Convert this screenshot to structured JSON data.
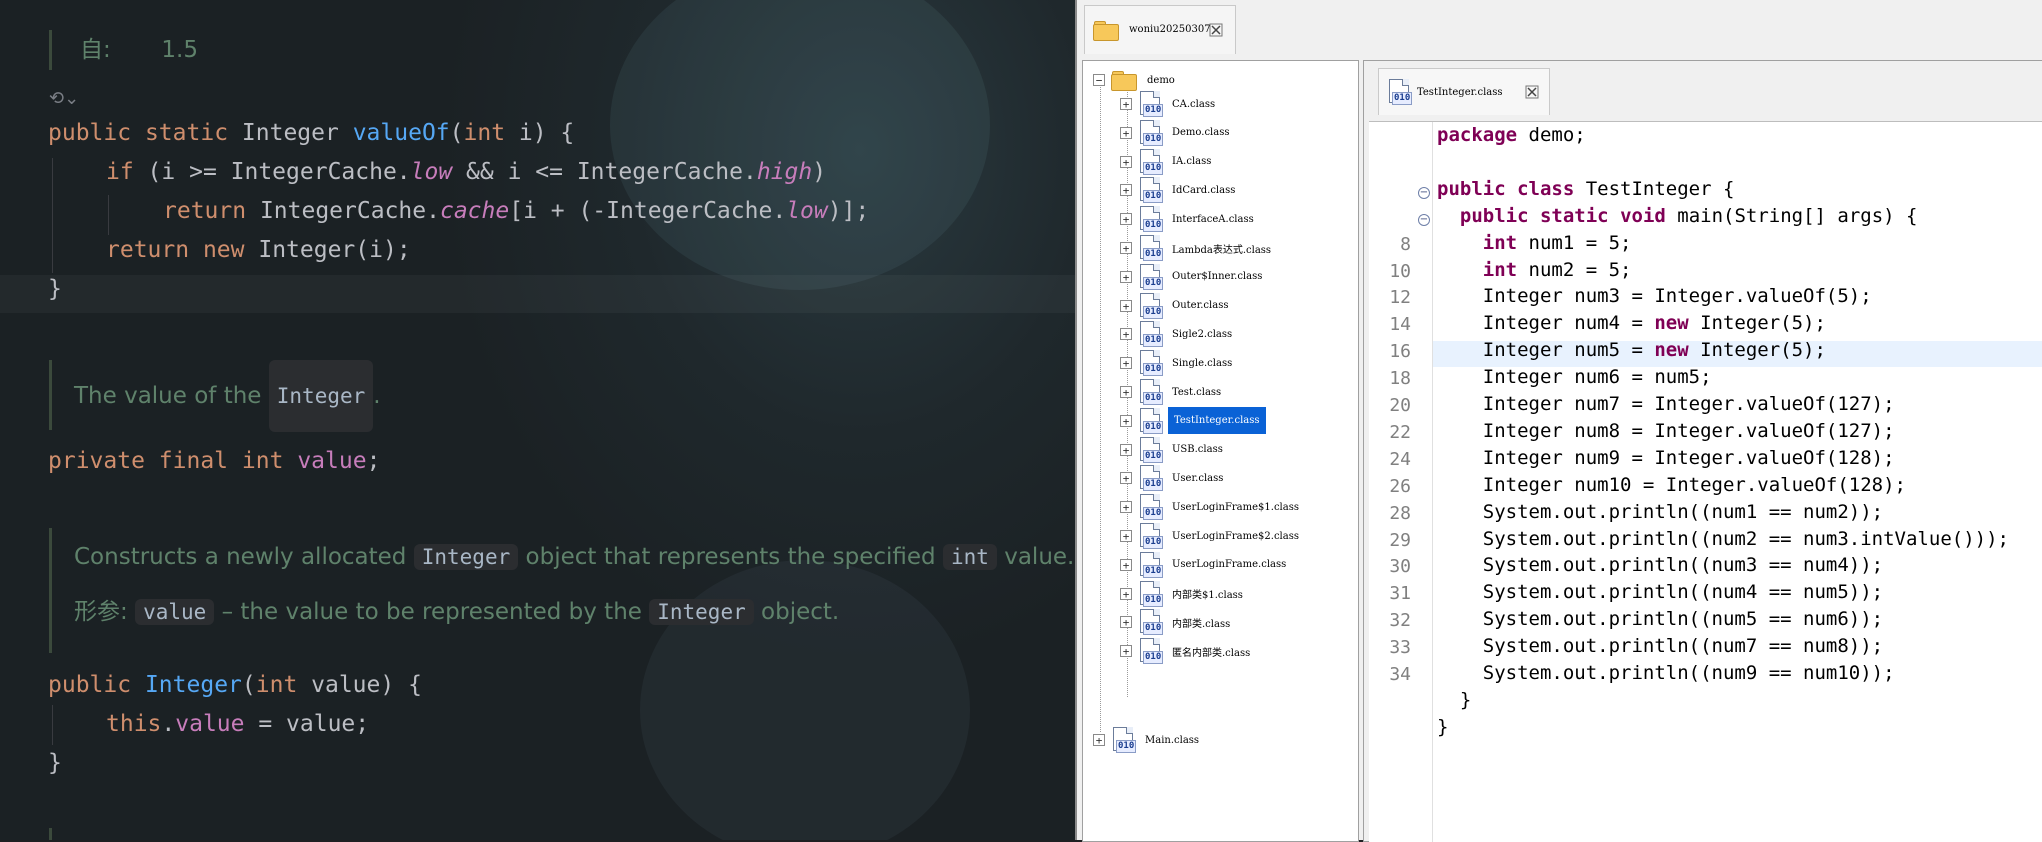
{
  "left_editor": {
    "inline_value_label": "自:",
    "inline_value": "1.5",
    "method_valueOf": {
      "l1": {
        "a": "public",
        "b": "static",
        "c": "Integer",
        "d": "valueOf",
        "e": "(",
        "f": "int",
        "g": " i) {"
      },
      "l2": {
        "a": "if",
        "b": " (i >= IntegerCache.",
        "c": "low",
        "d": " && i <= IntegerCache.",
        "e": "high",
        "f": ")"
      },
      "l3": {
        "a": "return",
        "b": " IntegerCache.",
        "c": "cache",
        "d": "[i + (-IntegerCache.",
        "e": "low",
        "f": ")];"
      },
      "l4": {
        "a": "return",
        "b": "new",
        "c": " Integer(i);"
      },
      "l5": "}"
    },
    "doc_value": {
      "pre": "The value of the ",
      "chip": "Integer",
      "post": "."
    },
    "field_line": {
      "a": "private",
      "b": "final",
      "c": "int",
      "d": "value",
      "e": ";"
    },
    "doc_ctor": {
      "p1": "Constructs a newly allocated ",
      "c1": "Integer",
      "p2": " object that represents the specified ",
      "c2": "int",
      "p3": " value.",
      "param_label": "形参:",
      "param_chip": "value",
      "param_text": " – the value to be represented by the ",
      "param_chip2": "Integer",
      "param_end": " object."
    },
    "ctor": {
      "l1": {
        "a": "public",
        "b": "Integer",
        "c": "(",
        "d": "int",
        "e": " value) {"
      },
      "l2": {
        "a": "this",
        "b": ".",
        "c": "value",
        "d": " = value;"
      },
      "l3": "}"
    }
  },
  "decompiler": {
    "window_tab": "woniu20250307",
    "tree_root": "demo",
    "tree_items": [
      "CA.class",
      "Demo.class",
      "IA.class",
      "IdCard.class",
      "InterfaceA.class",
      "Lambda表达式.class",
      "Outer$Inner.class",
      "Outer.class",
      "Sigle2.class",
      "Single.class",
      "Test.class",
      "TestInteger.class",
      "USB.class",
      "User.class",
      "UserLoginFrame$1.class",
      "UserLoginFrame$2.class",
      "UserLoginFrame.class",
      "内部类$1.class",
      "内部类.class",
      "匿名内部类.class"
    ],
    "selected_item": "TestInteger.class",
    "tree_last": "Main.class",
    "editor_tab": "TestInteger.class",
    "code_lines": [
      {
        "n": "",
        "t": "package demo;"
      },
      {
        "n": "",
        "t": ""
      },
      {
        "n": "",
        "t": "public class TestInteger {"
      },
      {
        "n": "",
        "t": "  public static void main(String[] args) {"
      },
      {
        "n": "8",
        "t": "    int num1 = 5;"
      },
      {
        "n": "10",
        "t": "    int num2 = 5;"
      },
      {
        "n": "12",
        "t": "    Integer num3 = Integer.valueOf(5);"
      },
      {
        "n": "14",
        "t": "    Integer num4 = new Integer(5);"
      },
      {
        "n": "16",
        "t": "    Integer num5 = new Integer(5);"
      },
      {
        "n": "18",
        "t": "    Integer num6 = num5;"
      },
      {
        "n": "20",
        "t": "    Integer num7 = Integer.valueOf(127);"
      },
      {
        "n": "22",
        "t": "    Integer num8 = Integer.valueOf(127);"
      },
      {
        "n": "24",
        "t": "    Integer num9 = Integer.valueOf(128);"
      },
      {
        "n": "26",
        "t": "    Integer num10 = Integer.valueOf(128);"
      },
      {
        "n": "28",
        "t": "    System.out.println((num1 == num2));"
      },
      {
        "n": "29",
        "t": "    System.out.println((num2 == num3.intValue()));"
      },
      {
        "n": "30",
        "t": "    System.out.println((num3 == num4));"
      },
      {
        "n": "31",
        "t": "    System.out.println((num4 == num5));"
      },
      {
        "n": "32",
        "t": "    System.out.println((num5 == num6));"
      },
      {
        "n": "33",
        "t": "    System.out.println((num7 == num8));"
      },
      {
        "n": "34",
        "t": "    System.out.println((num9 == num10));"
      },
      {
        "n": "",
        "t": "  }"
      },
      {
        "n": "",
        "t": "}"
      }
    ]
  }
}
